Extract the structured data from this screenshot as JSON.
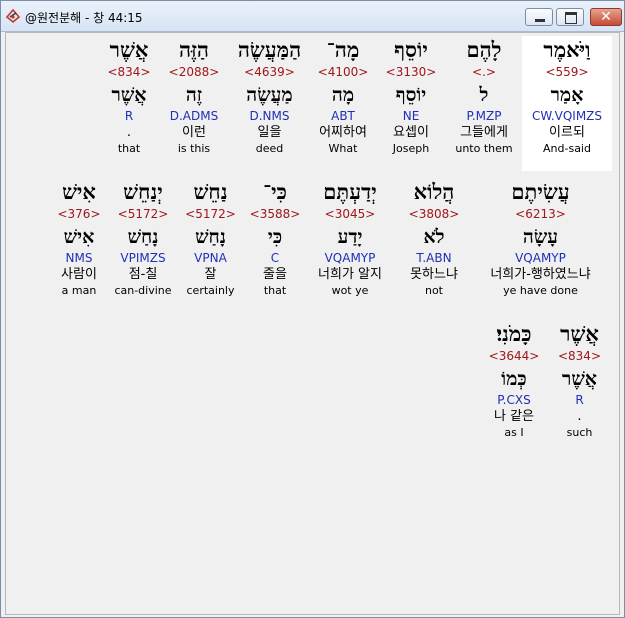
{
  "window": {
    "title": "@원전분해 - 창 44:15",
    "close_symbol": "✕"
  },
  "colors": {
    "strong_number": "#a0161a",
    "parsing": "#1f2fb8",
    "selected_background": "#ffffff"
  },
  "rows": [
    {
      "words": [
        {
          "hebrew": "וַיֹּאמֶר",
          "strong": "<559>",
          "lemma": "אָמַר",
          "parsing": "CW.VQIMZS",
          "korean": "이르되",
          "english": "And-said",
          "selected": true
        },
        {
          "hebrew": "לָהֶם",
          "strong": "<.>",
          "lemma": "ל",
          "parsing": "P.MZP",
          "korean": "그들에게",
          "english": "unto them"
        },
        {
          "hebrew": "יוֹסֵף",
          "strong": "<3130>",
          "lemma": "יוֹסֵף",
          "parsing": "NE",
          "korean": "요셉이",
          "english": "Joseph"
        },
        {
          "hebrew": "מָה־",
          "strong": "<4100>",
          "lemma": "מָה",
          "parsing": "ABT",
          "korean": "어찌하여",
          "english": "What"
        },
        {
          "hebrew": "הַמַּעֲשֶׂה",
          "strong": "<4639>",
          "lemma": "מַעֲשֶׂה",
          "parsing": "D.NMS",
          "korean": "일을",
          "english": "deed"
        },
        {
          "hebrew": "הַזֶּה",
          "strong": "<2088>",
          "lemma": "זֶה",
          "parsing": "D.ADMS",
          "korean": "이런",
          "english": "is this"
        },
        {
          "hebrew": "אֲשֶׁר",
          "strong": "<834>",
          "lemma": "אֲשֶׁר",
          "parsing": "R",
          "korean": ".",
          "english": "that"
        }
      ]
    },
    {
      "words": [
        {
          "hebrew": "עֲשִׂיתֶם",
          "strong": "<6213>",
          "lemma": "עָשָׂה",
          "parsing": "VQAMYP",
          "korean": "너희가-행하였느냐",
          "english": "ye have done"
        },
        {
          "hebrew": "הֲלוֹא",
          "strong": "<3808>",
          "lemma": "לֹא",
          "parsing": "T.ABN",
          "korean": "못하느냐",
          "english": "not"
        },
        {
          "hebrew": "יְדַעְתֶּם",
          "strong": "<3045>",
          "lemma": "יָדַע",
          "parsing": "VQAMYP",
          "korean": "너희가 알지",
          "english": "wot ye"
        },
        {
          "hebrew": "כִּי־",
          "strong": "<3588>",
          "lemma": "כִּי",
          "parsing": "C",
          "korean": "줄을",
          "english": "that"
        },
        {
          "hebrew": "נַחֵשׁ",
          "strong": "<5172>",
          "lemma": "נָחַשׁ",
          "parsing": "VPNA",
          "korean": "잘",
          "english": "certainly"
        },
        {
          "hebrew": "יְנַחֵשׁ",
          "strong": "<5172>",
          "lemma": "נָחַשׁ",
          "parsing": "VPIMZS",
          "korean": "점-칠",
          "english": "can-divine"
        },
        {
          "hebrew": "אִישׁ",
          "strong": "<376>",
          "lemma": "אִישׁ",
          "parsing": "NMS",
          "korean": "사람이",
          "english": "a man"
        }
      ]
    },
    {
      "words": [
        {
          "hebrew": "אֲשֶׁר",
          "strong": "<834>",
          "lemma": "אֲשֶׁר",
          "parsing": "R",
          "korean": ".",
          "english": "such"
        },
        {
          "hebrew": "כָּמֹנִי׃",
          "strong": "<3644>",
          "lemma": "כְּמוֹ",
          "parsing": "P.CXS",
          "korean": "나 같은",
          "english": "as I"
        }
      ]
    }
  ]
}
